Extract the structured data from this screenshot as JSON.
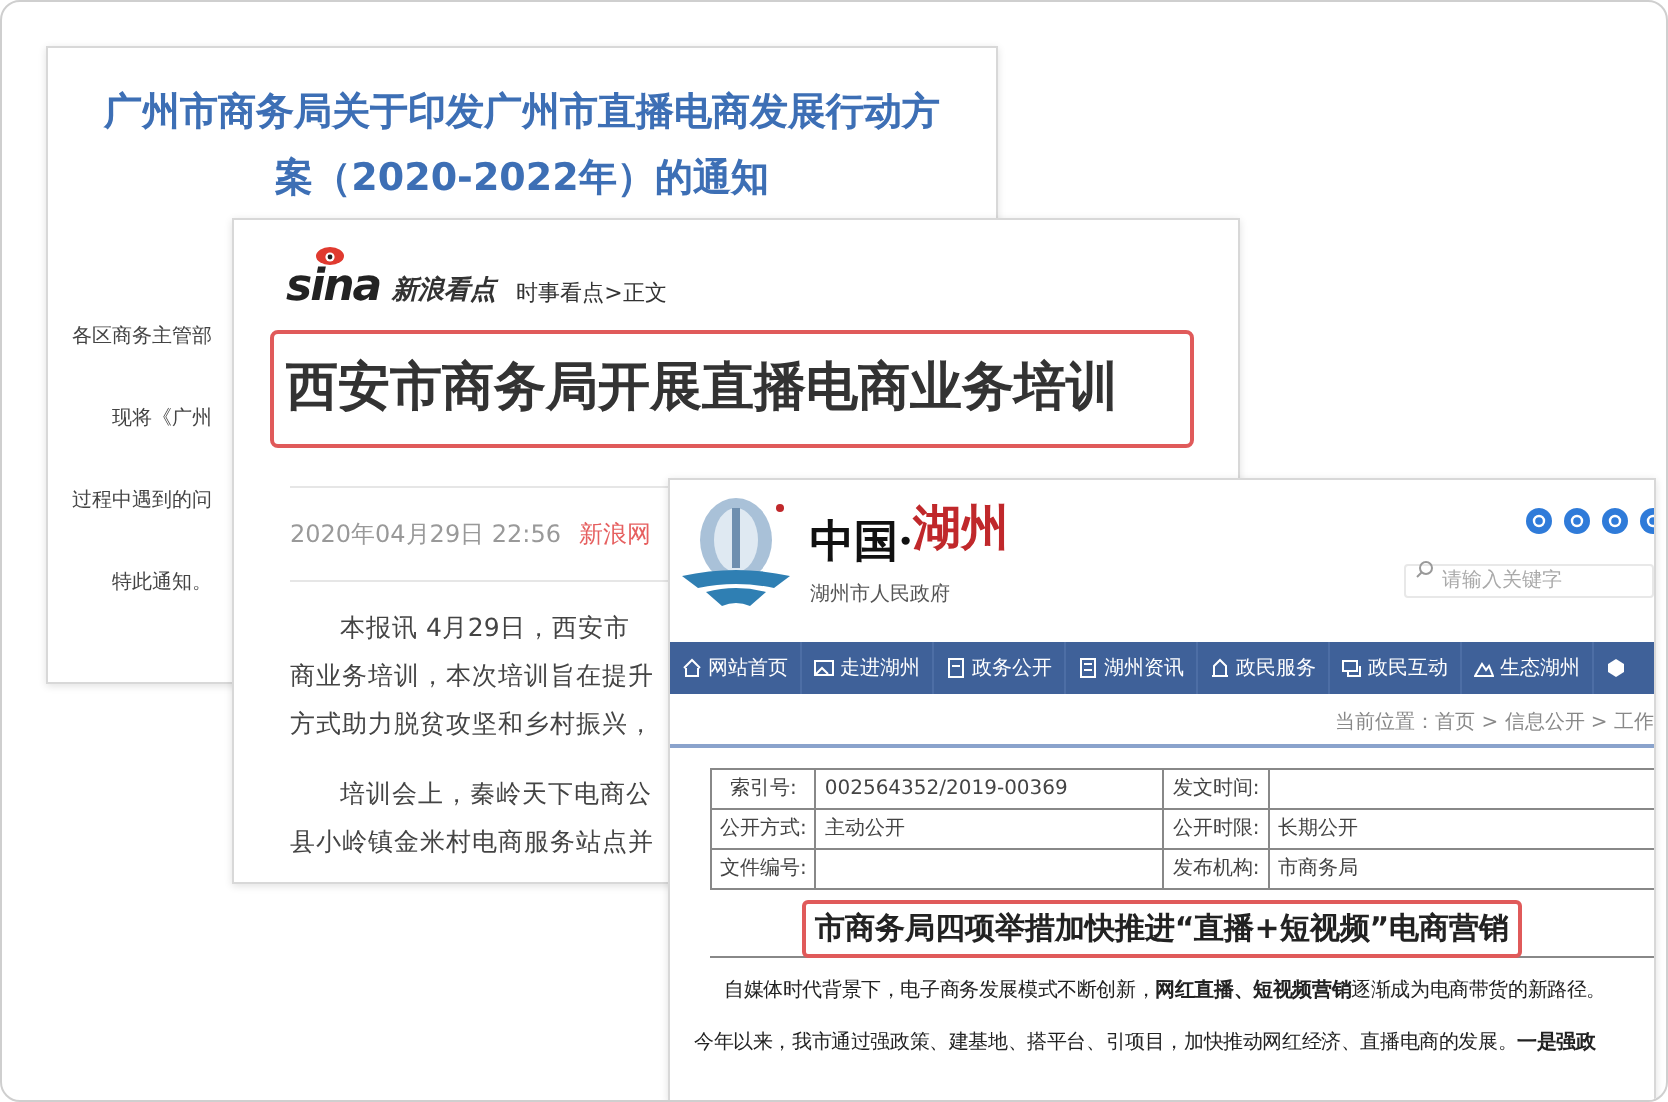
{
  "guangzhou_doc": {
    "title_lines": [
      "广州市商务局关于印发广州市直播电商发展行动方",
      "案（2020-2022年）的通知"
    ],
    "body_lines": [
      {
        "text": "各区商务主管部",
        "indent": false
      },
      {
        "text": "现将《广州",
        "indent": true
      },
      {
        "text": "过程中遇到的问",
        "indent": false
      },
      {
        "text": "特此通知。",
        "indent": true
      }
    ]
  },
  "sina_article": {
    "logo": "sina",
    "logo_sub": "新浪看点",
    "breadcrumb": "时事看点>正文",
    "title": "西安市商务局开展直播电商业务培训",
    "date": "2020年04月29日 22:56",
    "source": "新浪网",
    "paragraphs": [
      [
        "本报讯 4月29日，西安市",
        "商业务培训，本次培训旨在提升",
        "方式助力脱贫攻坚和乡村振兴，"
      ],
      [
        "培训会上，秦岭天下电商公",
        "县小岭镇金米村电商服务站点并"
      ]
    ]
  },
  "huzhou_page": {
    "logo_text": "中国·",
    "logo_accent": "湖州",
    "site_name": "湖州市人民政府",
    "search": {
      "placeholder": "请输入关键字"
    },
    "nav": [
      {
        "label": "网站首页"
      },
      {
        "label": "走进湖州"
      },
      {
        "label": "政务公开"
      },
      {
        "label": "湖州资讯"
      },
      {
        "label": "政民服务"
      },
      {
        "label": "政民互动"
      },
      {
        "label": "生态湖州"
      }
    ],
    "breadcrumb": "当前位置：首页 > 信息公开 > 工作",
    "info_table": [
      {
        "label_1": "索引号:",
        "value_1": "002564352/2019-00369",
        "label_2": "发文时间:"
      },
      {
        "label_1": "公开方式:",
        "value_1": "主动公开",
        "label_2": "公开时限:",
        "value_2": "长期公开"
      },
      {
        "label_1": "文件编号:",
        "label_2": "发布机构:",
        "value_2": "市商务局"
      }
    ],
    "title": "市商务局四项举措加快推进“直播+短视频”电商营销",
    "body_lines": [
      {
        "text": "自媒体时代背景下，电子商务发展模式不断创新，**网红直播、短视频营销**逐渐成为电商带货的新路径。",
        "indent": true
      },
      {
        "text": "今年以来，我市通过强政策、建基地、搭平台、引项目，加快推动网红经济、直播电商的发展。**一是强政**",
        "indent": false
      }
    ]
  }
}
